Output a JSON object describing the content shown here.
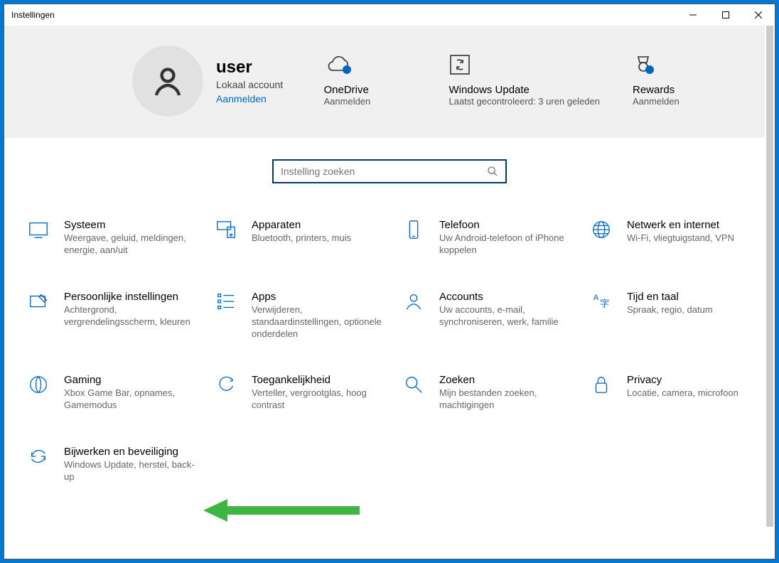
{
  "window_title": "Instellingen",
  "user": {
    "name": "user",
    "account_type": "Lokaal account",
    "sign_in": "Aanmelden"
  },
  "header_cards": {
    "onedrive": {
      "title": "OneDrive",
      "sub": "Aanmelden"
    },
    "update": {
      "title": "Windows Update",
      "sub": "Laatst gecontroleerd: 3 uren geleden"
    },
    "rewards": {
      "title": "Rewards",
      "sub": "Aanmelden"
    }
  },
  "search_placeholder": "Instelling zoeken",
  "tiles": [
    {
      "title": "Systeem",
      "desc": "Weergave, geluid, meldingen, energie, aan/uit"
    },
    {
      "title": "Apparaten",
      "desc": "Bluetooth, printers, muis"
    },
    {
      "title": "Telefoon",
      "desc": "Uw Android-telefoon of iPhone koppelen"
    },
    {
      "title": "Netwerk en internet",
      "desc": "Wi-Fi, vliegtuigstand, VPN"
    },
    {
      "title": "Persoonlijke instellingen",
      "desc": "Achtergrond, vergrendelingsscherm, kleuren"
    },
    {
      "title": "Apps",
      "desc": "Verwijderen, standaardinstellingen, optionele onderdelen"
    },
    {
      "title": "Accounts",
      "desc": "Uw accounts, e-mail, synchroniseren, werk, familie"
    },
    {
      "title": "Tijd en taal",
      "desc": "Spraak, regio, datum"
    },
    {
      "title": "Gaming",
      "desc": "Xbox Game Bar, opnames, Gamemodus"
    },
    {
      "title": "Toegankelijkheid",
      "desc": "Verteller, vergrootglas, hoog contrast"
    },
    {
      "title": "Zoeken",
      "desc": "Mijn bestanden zoeken, machtigingen"
    },
    {
      "title": "Privacy",
      "desc": "Locatie, camera, microfoon"
    },
    {
      "title": "Bijwerken en beveiliging",
      "desc": "Windows Update, herstel, back-up"
    }
  ]
}
